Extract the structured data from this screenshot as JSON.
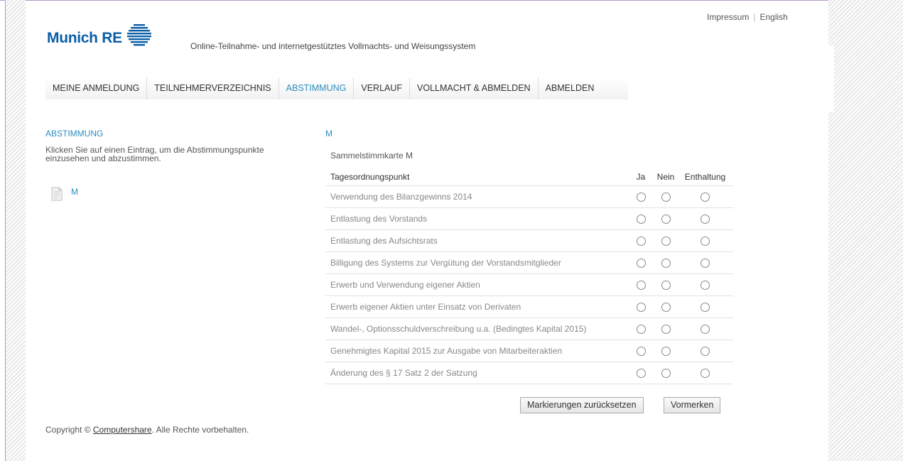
{
  "header": {
    "brand": "Munich RE",
    "site_title": "Online-Teilnahme- und internetgestütztes Vollmachts- und Weisungssystem",
    "links": {
      "imprint": "Impressum",
      "separator": "|",
      "language": "English"
    }
  },
  "nav": {
    "active": "ABSTIMMUNG",
    "tabs": [
      {
        "label": "MEINE ANMELDUNG"
      },
      {
        "label": "TEILNEHMERVERZEICHNIS"
      },
      {
        "label": "ABSTIMMUNG"
      },
      {
        "label": "VERLAUF"
      },
      {
        "label": "VOLLMACHT & ABMELDEN"
      },
      {
        "label": "ABMELDEN"
      }
    ]
  },
  "sidebar": {
    "heading": "ABSTIMMUNG",
    "intro": "Klicken Sie auf einen Eintrag, um die Abstimmungspunkte einzusehen und abzustimmen.",
    "entries": [
      {
        "label": "M",
        "icon": "document-icon"
      }
    ]
  },
  "ballot": {
    "heading": "M",
    "card_title": "Sammelstimmkarte M",
    "columns": {
      "item": "Tagesordnungspunkt",
      "yes": "Ja",
      "no": "Nein",
      "abstain": "Enthaltung"
    },
    "items": [
      {
        "label": "Verwendung des Bilanzgewinns 2014"
      },
      {
        "label": "Entlastung des Vorstands"
      },
      {
        "label": "Entlastung des Aufsichtsrats"
      },
      {
        "label": "Billigung des Systems zur Vergütung der Vorstandsmitglieder"
      },
      {
        "label": "Erwerb und Verwendung eigener Aktien"
      },
      {
        "label": "Erwerb eigener Aktien unter Einsatz von Derivaten"
      },
      {
        "label": "Wandel-, Optionsschuldverschreibung u.a. (Bedingtes Kapital 2015)"
      },
      {
        "label": "Genehmigtes Kapital 2015 zur Ausgabe von Mitarbeiteraktien"
      },
      {
        "label": "Änderung des § 17 Satz 2 der Satzung"
      }
    ],
    "buttons": {
      "reset": "Markierungen zurücksetzen",
      "save": "Vormerken"
    }
  },
  "footer": {
    "prefix": "Copyright ©",
    "link": "Computershare",
    "suffix": ". Alle Rechte vorbehalten."
  },
  "colors": {
    "brand": "#0a5ea8",
    "accent": "#2e8ec0",
    "frame": "#b49ac8"
  }
}
